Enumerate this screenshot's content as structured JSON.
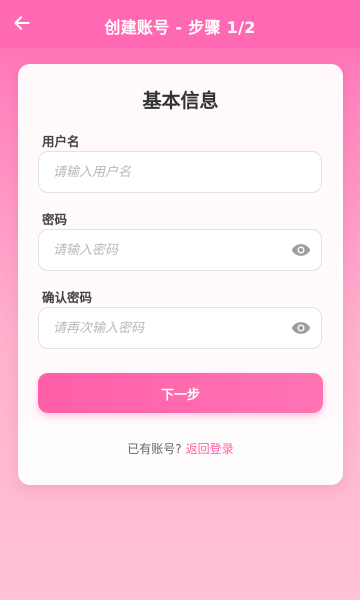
{
  "header": {
    "back_icon": "arrow-left-icon",
    "title": "创建账号 - 步骤 1/2",
    "background": "#ff69b4"
  },
  "form": {
    "title": "基本信息",
    "username": {
      "label": "用户名",
      "placeholder": "请输入用户名",
      "value": ""
    },
    "password": {
      "label": "密码",
      "placeholder": "请输入密码",
      "value": "",
      "toggle_icon": "eye-icon"
    },
    "confirm_password": {
      "label": "确认密码",
      "placeholder": "请再次输入密码",
      "value": "",
      "toggle_icon": "eye-icon"
    },
    "next_button": "下一步"
  },
  "footer": {
    "prompt": "已有账号?",
    "login_link": "返回登录"
  },
  "colors": {
    "accent": "#ff5fa8",
    "text_dark": "#333333",
    "muted": "#666666"
  }
}
